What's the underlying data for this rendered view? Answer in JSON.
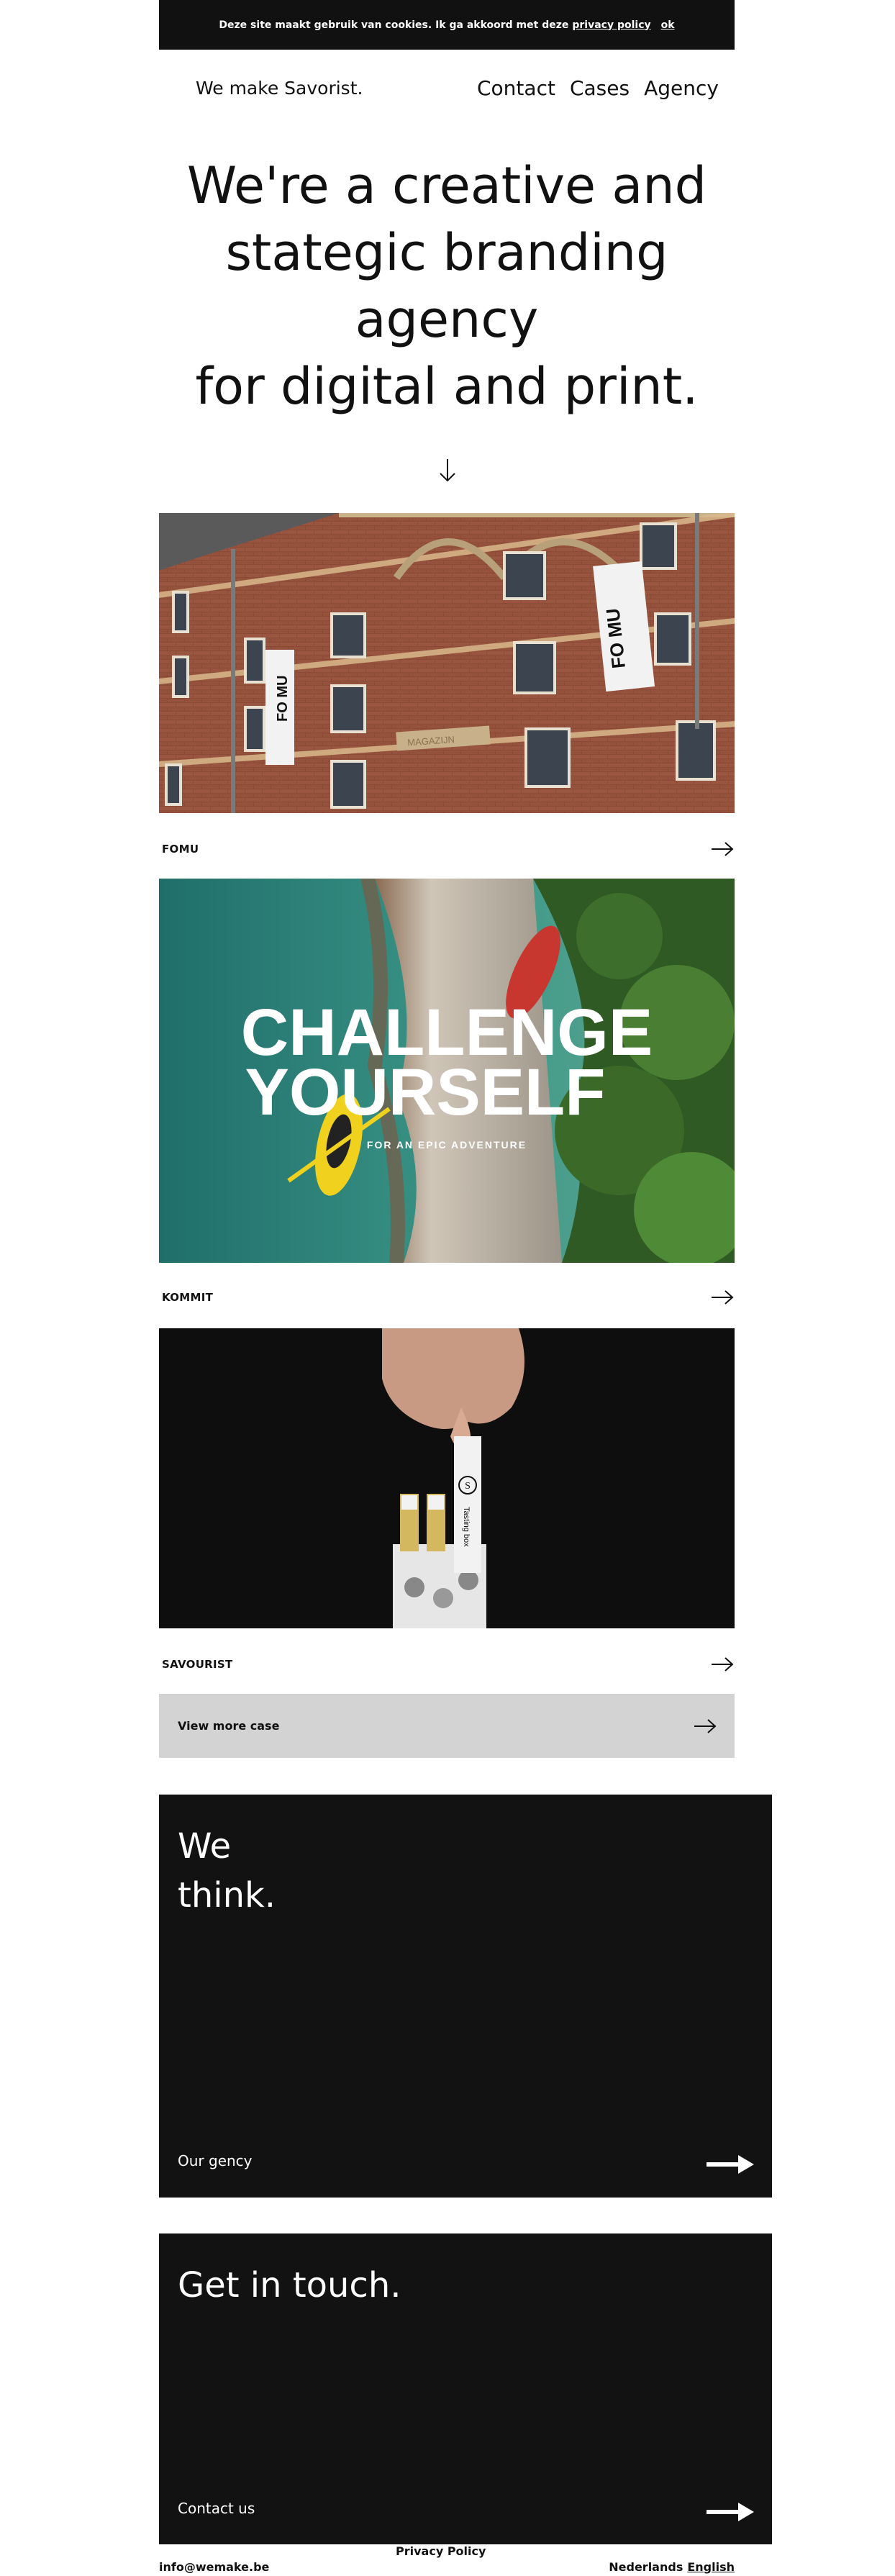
{
  "cookie_bar": {
    "message": "Deze site maakt gebruik van cookies. Ik ga akkoord met deze",
    "policy_link": "privacy policy",
    "ok_label": "ok"
  },
  "header": {
    "brand": "We make Savorist.",
    "nav": [
      "Contact",
      "Cases",
      "Agency"
    ]
  },
  "hero": {
    "line1": "We're a creative and",
    "line2": "stategic branding agency",
    "line3": "for digital and print."
  },
  "cases": [
    {
      "name": "FOMU",
      "image": {
        "banner_left": "FO MU",
        "banner_right": "FO MU",
        "sign": "MAGAZIJN"
      }
    },
    {
      "name": "KOMMIT",
      "image": {
        "headline1": "CHALLENGE",
        "headline2": "YOURSELF",
        "tagline": "FOR AN EPIC ADVENTURE"
      }
    },
    {
      "name": "SAVOURIST",
      "image": {
        "bottle_label": "Tasting box",
        "bottle_logo": "S"
      }
    }
  ],
  "view_more": {
    "label": "View more case"
  },
  "blocks": {
    "think": {
      "title_line1": "We",
      "title_line2": "think.",
      "link": "Our gency"
    },
    "touch": {
      "title": "Get in touch.",
      "link": "Contact us"
    }
  },
  "footer": {
    "privacy": "Privacy Policy",
    "email": "info@wemake.be",
    "lang_nl": "Nederlands",
    "lang_en": "English"
  },
  "colors": {
    "dark": "#121212",
    "view_more_bg": "#d3d3d3",
    "text": "#111111"
  }
}
